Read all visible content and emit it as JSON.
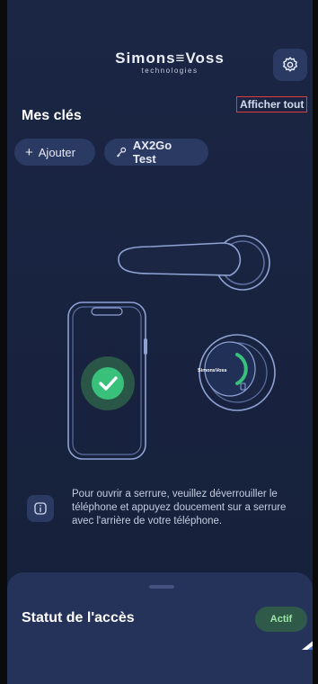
{
  "header": {
    "logo_main": "Simons≡Voss",
    "logo_sub": "technologies",
    "settings_icon": "gear-icon"
  },
  "keys": {
    "title": "Mes clés",
    "show_all": "Afficher tout",
    "add_chip": {
      "icon": "plus",
      "label": "Ajouter"
    },
    "key_chip": {
      "icon": "key-icon",
      "label": "AX2Go Test"
    }
  },
  "illustration": {
    "lock_brand": "SimonsVoss",
    "check_icon": "check-icon"
  },
  "info": {
    "icon": "info-icon",
    "text": "Pour ouvrir a serrure, veuillez déverrouiller le téléphone et appuyez doucement sur a serrure avec l'arrière de votre téléphone."
  },
  "access": {
    "title": "Statut de l'accès",
    "status": "Actif"
  },
  "colors": {
    "background": "#1b2644",
    "chip": "#2b3a63",
    "accent_green": "#39c07a",
    "line": "#7f92c4",
    "highlight_box": "#e23b3b"
  }
}
